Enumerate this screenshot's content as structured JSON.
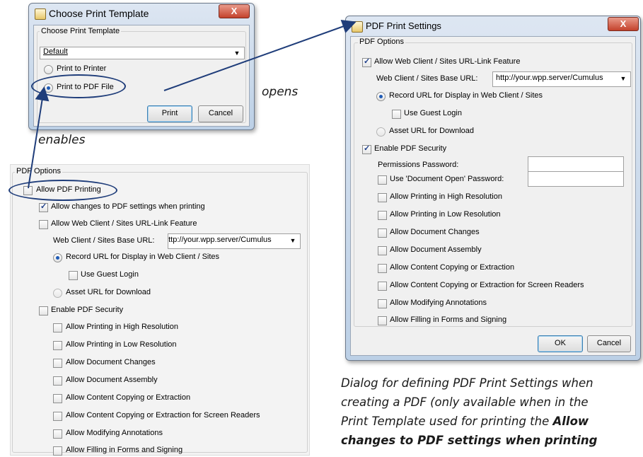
{
  "dialog1": {
    "title": "Choose Print Template",
    "close": "X",
    "group_label": "Choose Print Template",
    "template_value": "Default",
    "dropdown_arrow": "▼",
    "radio_printer": "Print to Printer",
    "radio_pdf": "Print to PDF File",
    "print_button": "Print",
    "cancel_button": "Cancel"
  },
  "annotations": {
    "opens": "opens",
    "enables": "enables",
    "caption_line1": "Dialog for defining PDF Print Settings when",
    "caption_line2": "creating a PDF (only available when in the",
    "caption_line3": "Print Template used for printing the ",
    "caption_bold3": "Allow",
    "caption_bold4": "changes to PDF settings when printing"
  },
  "left_panel": {
    "legend": "PDF Options",
    "allow_pdf_printing": "Allow PDF Printing",
    "allow_changes": "Allow changes to PDF settings when printing",
    "web_client_feature": "Allow Web Client / Sites URL-Link Feature",
    "base_url_label": "Web Client / Sites Base URL:",
    "base_url_value": "http://your.wpp.server/Cumulus",
    "dropdown_arrow": "▼",
    "record_url": "Record URL for Display in Web Client / Sites",
    "use_guest_login": "Use Guest Login",
    "asset_url": "Asset URL for Download",
    "enable_security": "Enable PDF Security",
    "perms": [
      "Allow Printing in High Resolution",
      "Allow Printing in Low Resolution",
      "Allow Document Changes",
      "Allow Document Assembly",
      "Allow Content Copying or Extraction",
      "Allow Content Copying or Extraction for Screen Readers",
      "Allow Modifying Annotations",
      "Allow Filling in Forms and Signing"
    ]
  },
  "dialog2": {
    "title": "PDF Print Settings",
    "close": "X",
    "legend": "PDF Options",
    "web_client_feature": "Allow Web Client / Sites URL-Link Feature",
    "base_url_label": "Web Client / Sites Base URL:",
    "base_url_value": "http://your.wpp.server/Cumulus",
    "dropdown_arrow": "▼",
    "record_url": "Record URL for Display in Web Client / Sites",
    "use_guest_login": "Use Guest Login",
    "asset_url": "Asset URL for Download",
    "enable_security": "Enable PDF Security",
    "permissions_password": "Permissions Password:",
    "use_doc_open_password": "Use 'Document Open' Password:",
    "perms": [
      "Allow Printing in High Resolution",
      "Allow Printing in Low Resolution",
      "Allow Document Changes",
      "Allow Document Assembly",
      "Allow Content Copying or Extraction",
      "Allow Content Copying or Extraction for Screen Readers",
      "Allow Modifying Annotations",
      "Allow Filling in Forms and Signing"
    ],
    "ok_button": "OK",
    "cancel_button": "Cancel"
  },
  "colors": {
    "annotation": "#1f3d7a",
    "accent": "#1f5bb5"
  }
}
